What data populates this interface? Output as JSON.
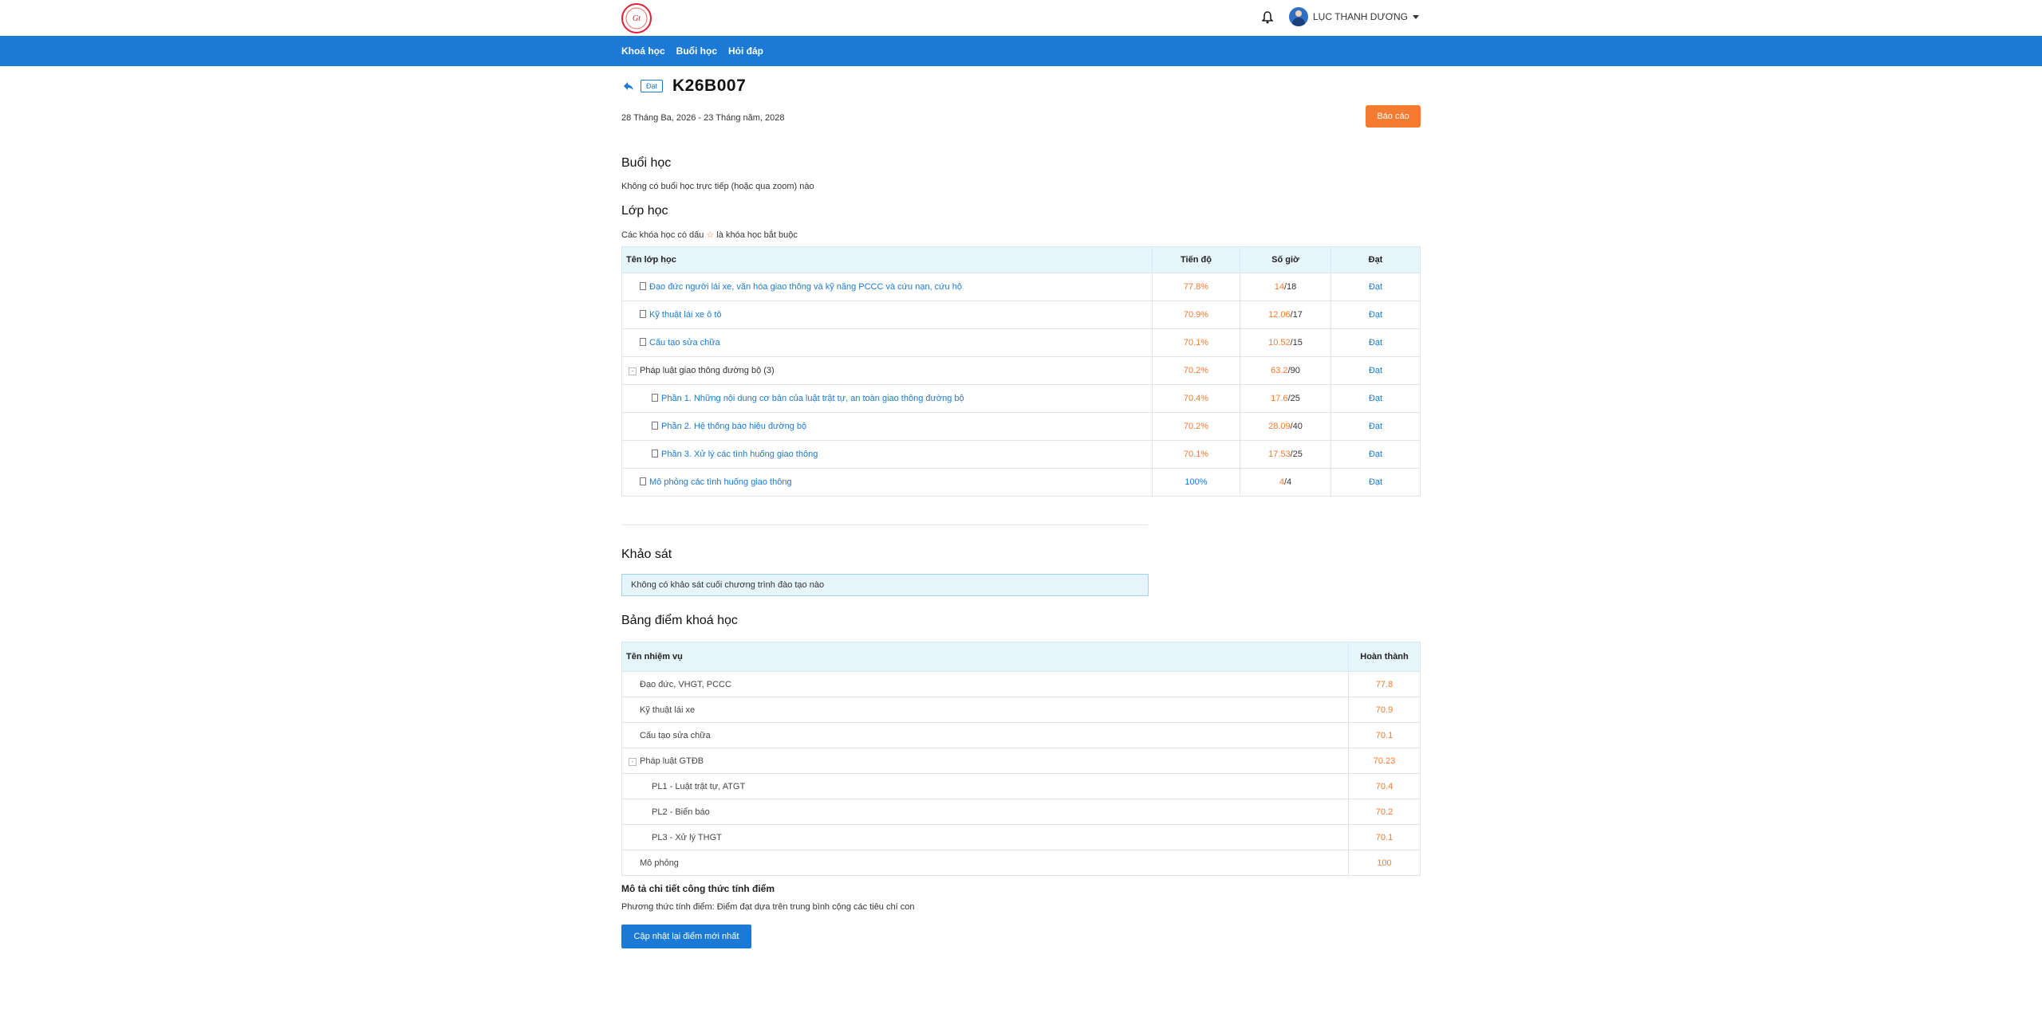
{
  "header": {
    "user_name": "LỤC THANH DƯƠNG",
    "nav": [
      "Khoá học",
      "Buổi học",
      "Hỏi đáp"
    ]
  },
  "course": {
    "badge": "Đạt",
    "title": "K26B007",
    "date_range": "28 Tháng Ba, 2026 - 23 Tháng năm, 2028",
    "report_button": "Báo cáo"
  },
  "sessions": {
    "heading": "Buổi học",
    "note": "Không có buổi học trực tiếp (hoặc qua zoom) nào"
  },
  "classes": {
    "heading": "Lớp học",
    "note_before": "Các khóa học có dấu",
    "note_star": "☆",
    "note_after": "là khóa học bắt buộc",
    "columns": [
      "Tên lớp học",
      "Tiến độ",
      "Số giờ",
      "Đạt"
    ],
    "rows": [
      {
        "name": "Đạo đức người lái xe, văn hóa giao thông và kỹ năng PCCC và cứu nạn, cứu hộ",
        "progress": "77.8%",
        "hours_done": "14",
        "hours_total": "/18",
        "status": "Đạt"
      },
      {
        "name": "Kỹ thuật lái xe ô tô",
        "progress": "70.9%",
        "hours_done": "12.06",
        "hours_total": "/17",
        "status": "Đạt"
      },
      {
        "name": "Cấu tạo sửa chữa",
        "progress": "70.1%",
        "hours_done": "10.52",
        "hours_total": "/15",
        "status": "Đạt"
      },
      {
        "name": "Pháp luật giao thông đường bộ",
        "count": "(3)",
        "toggle": "-",
        "progress": "70.2%",
        "hours_done": "63.2",
        "hours_total": "/90",
        "status": "Đạt"
      },
      {
        "name": "Phần 1. Những nội dung cơ bản của luật trật tự, an toàn giao thông đường bộ",
        "progress": "70.4%",
        "hours_done": "17.6",
        "hours_total": "/25",
        "status": "Đạt"
      },
      {
        "name": "Phần 2. Hệ thống báo hiệu đường bộ",
        "progress": "70.2%",
        "hours_done": "28.09",
        "hours_total": "/40",
        "status": "Đạt"
      },
      {
        "name": "Phần 3. Xử lý các tình huống giao thông",
        "progress": "70.1%",
        "hours_done": "17.53",
        "hours_total": "/25",
        "status": "Đạt"
      },
      {
        "name": "Mô phỏng các tình huống giao thông",
        "progress": "100%",
        "hours_done": "4",
        "hours_total": "/4",
        "status": "Đạt"
      }
    ]
  },
  "survey": {
    "heading": "Khảo sát",
    "note": "Không có khảo sát cuối chương trình đào tạo nào"
  },
  "grades": {
    "heading": "Bảng điểm khoá học",
    "columns": [
      "Tên nhiệm vụ",
      "Hoàn thành"
    ],
    "rows": [
      {
        "name": "Đạo đức, VHGT, PCCC",
        "score": "77.8"
      },
      {
        "name": "Kỹ thuật lái xe",
        "score": "70.9"
      },
      {
        "name": "Cấu tạo sửa chữa",
        "score": "70.1"
      },
      {
        "name": "Pháp luật GTĐB",
        "toggle": "-",
        "score": "70.23"
      },
      {
        "name": "PL1 - Luật trật tự, ATGT",
        "score": "70.4"
      },
      {
        "name": "PL2 - Biển báo",
        "score": "70.2"
      },
      {
        "name": "PL3 - Xử lý THGT",
        "score": "70.1"
      },
      {
        "name": "Mô phỏng",
        "score": "100"
      }
    ]
  },
  "formula": {
    "title": "Mô tả chi tiết công thức tính điểm",
    "text": "Phương thức tính điểm: Điểm đạt dựa trên trung bình cộng các tiêu chí con",
    "update_button": "Cập nhật lại điểm mới nhất"
  }
}
